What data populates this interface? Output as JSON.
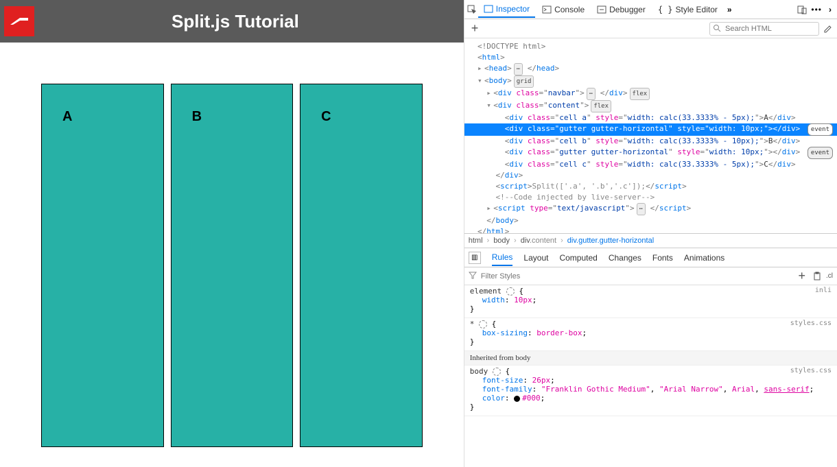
{
  "page": {
    "title": "Split.js Tutorial",
    "cells": {
      "a": "A",
      "b": "B",
      "c": "C"
    }
  },
  "devtools": {
    "tabs": {
      "inspector": "Inspector",
      "console": "Console",
      "debugger": "Debugger",
      "style_editor": "Style Editor"
    },
    "search_placeholder": "Search HTML",
    "dom": {
      "doctype": "<!DOCTYPE html>",
      "html_open": "html",
      "head": "head",
      "body": "body",
      "body_badge": "grid",
      "nav_div": "div",
      "nav_class": "navbar",
      "nav_badge": "flex",
      "content_div": "div",
      "content_class": "content",
      "content_badge": "flex",
      "cell_a_class": "cell a",
      "cell_a_style": "width: calc(33.3333% - 5px);",
      "cell_a_txt": "A",
      "gutter1_class": "gutter gutter-horizontal",
      "gutter1_style": "width: 10px;",
      "gutter1_ev": "event",
      "cell_b_class": "cell b",
      "cell_b_style": "width: calc(33.3333% - 10px);",
      "cell_b_txt": "B",
      "gutter2_class": "gutter gutter-horizontal",
      "gutter2_style": "width: 10px;",
      "gutter2_ev": "event",
      "cell_c_class": "cell c",
      "cell_c_style": "width: calc(33.3333% - 5px);",
      "cell_c_txt": "C",
      "script1": "Split(['.a', '.b','.c']);",
      "comment": "Code injected by live-server",
      "script2_type": "text/javascript"
    },
    "breadcrumb": {
      "p1": "html",
      "p2": "body",
      "p3": "div",
      "p3c": ".content",
      "p4": "div",
      "p4c": ".gutter.gutter-horizontal"
    },
    "rules_tabs": {
      "rules": "Rules",
      "layout": "Layout",
      "computed": "Computed",
      "changes": "Changes",
      "fonts": "Fonts",
      "animations": "Animations"
    },
    "filter_placeholder": "Filter Styles",
    "rules": {
      "r1": {
        "sel": "element",
        "src": "inli",
        "p1": "width",
        "v1": "10px"
      },
      "r2": {
        "sel": "*",
        "src": "styles.css",
        "p1": "box-sizing",
        "v1": "border-box"
      },
      "inh": "Inherited from body",
      "r3": {
        "sel": "body",
        "src": "styles.css",
        "p1": "font-size",
        "v1": "26px",
        "p2": "font-family",
        "v2a": "\"Franklin Gothic Medium\"",
        "v2b": "\"Arial Narrow\"",
        "v2c": "Arial",
        "v2d": "sans-serif",
        "p3": "color",
        "v3": "#000"
      }
    }
  }
}
